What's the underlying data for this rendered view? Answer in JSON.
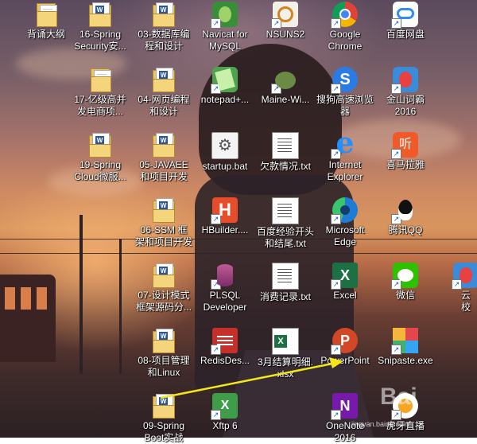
{
  "desktop": {
    "icons": [
      {
        "label": "背诵大纲",
        "icon": "folder-icon"
      },
      {
        "label": "16-Spring\nSecurity安...",
        "icon": "folder-icon"
      },
      {
        "label": "03-数据库编\n程和设计",
        "icon": "folder-icon"
      },
      {
        "label": "Navicat for\nMySQL",
        "icon": "navicat-icon"
      },
      {
        "label": "NSUNS2",
        "icon": "nsuns-icon"
      },
      {
        "label": "Google\nChrome",
        "icon": "chrome-icon"
      },
      {
        "label": "百度网盘",
        "icon": "baidu-netdisk-icon"
      },
      {
        "label": "17-亿级高并\n发电商项...",
        "icon": "folder-icon"
      },
      {
        "label": "04-网页编程\n和设计",
        "icon": "folder-icon"
      },
      {
        "label": "notepad+...",
        "icon": "notepad-plus-icon"
      },
      {
        "label": "Maine-Wi...",
        "icon": "maine-icon"
      },
      {
        "label": "搜狗高速浏览\n器",
        "icon": "sogou-browser-icon"
      },
      {
        "label": "金山词霸\n2016",
        "icon": "kingsoft-icon"
      },
      {
        "label": "19-Spring\nCloud微服...",
        "icon": "folder-icon"
      },
      {
        "label": "05-JAVAEE\n和项目开发",
        "icon": "folder-icon"
      },
      {
        "label": "startup.bat",
        "icon": "bat-file-icon"
      },
      {
        "label": "欠款情况.txt",
        "icon": "text-file-icon"
      },
      {
        "label": "Internet\nExplorer",
        "icon": "internet-explorer-icon"
      },
      {
        "label": "喜马拉雅",
        "icon": "ximalaya-icon"
      },
      {
        "label": "06-SSM 框\n架和项目开发",
        "icon": "folder-icon"
      },
      {
        "label": "HBuilder....",
        "icon": "hbuilder-icon"
      },
      {
        "label": "百度经验开头\n和结尾.txt",
        "icon": "text-file-icon"
      },
      {
        "label": "Microsoft\nEdge",
        "icon": "edge-icon"
      },
      {
        "label": "腾讯QQ",
        "icon": "qq-icon"
      },
      {
        "label": "07-设计模式\n框架源码分...",
        "icon": "folder-icon"
      },
      {
        "label": "PLSQL\nDeveloper",
        "icon": "plsql-icon"
      },
      {
        "label": "消费记录.txt",
        "icon": "text-file-icon"
      },
      {
        "label": "Excel",
        "icon": "excel-icon"
      },
      {
        "label": "微信",
        "icon": "wechat-icon"
      },
      {
        "label": "08-项目管理\n和Linux",
        "icon": "folder-icon"
      },
      {
        "label": "RedisDes...",
        "icon": "redis-desktop-icon"
      },
      {
        "label": "3月结算明细.\nxlsx",
        "icon": "xlsx-file-icon"
      },
      {
        "label": "PowerPoint",
        "icon": "powerpoint-icon"
      },
      {
        "label": "Snipaste.exe",
        "icon": "snipaste-icon"
      },
      {
        "label": "09-Spring\nBoot实战",
        "icon": "folder-icon"
      },
      {
        "label": "Xftp 6",
        "icon": "xftp-icon"
      },
      {
        "label": "OneNote\n2016",
        "icon": "onenote-icon"
      },
      {
        "label": "虎牙直播",
        "icon": "huya-icon"
      },
      {
        "label": "云\n校",
        "icon": "app-icon"
      }
    ]
  },
  "annotation": {
    "arrow_color": "#f5e61a"
  },
  "watermark": {
    "text": "Bai",
    "url": "jingyan.baidu.com"
  }
}
